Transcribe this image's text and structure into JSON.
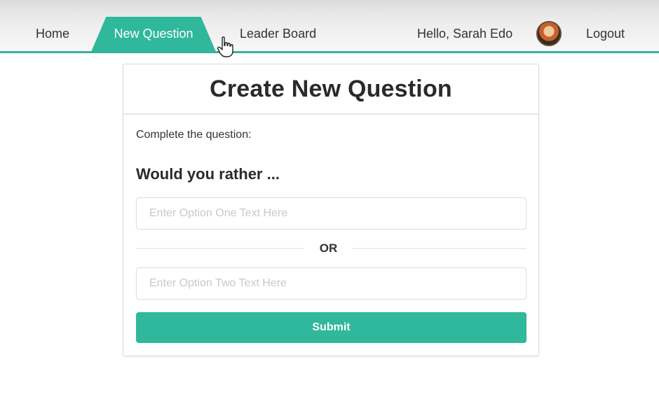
{
  "nav": {
    "home_label": "Home",
    "new_question_label": "New Question",
    "leader_board_label": "Leader Board",
    "greeting": "Hello, Sarah Edo",
    "logout_label": "Logout",
    "active_tab": "New Question"
  },
  "colors": {
    "accent": "#2fb89b",
    "nav_underline": "#3aaf98"
  },
  "icons": {
    "avatar": "user-avatar",
    "cursor": "hand-pointer-icon"
  },
  "form": {
    "title": "Create New Question",
    "instruction": "Complete the question:",
    "prompt": "Would you rather ...",
    "option_one": {
      "value": "",
      "placeholder": "Enter Option One Text Here"
    },
    "separator": "OR",
    "option_two": {
      "value": "",
      "placeholder": "Enter Option Two Text Here"
    },
    "submit_label": "Submit"
  }
}
